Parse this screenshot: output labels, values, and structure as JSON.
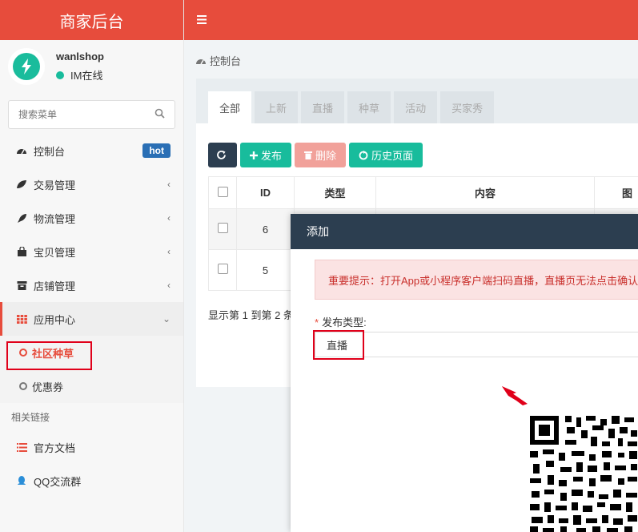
{
  "app": {
    "title": "商家后台"
  },
  "user": {
    "name": "wanlshop",
    "status": "IM在线"
  },
  "search": {
    "placeholder": "搜索菜单"
  },
  "menu": {
    "items": [
      {
        "label": "控制台",
        "badge": "hot"
      },
      {
        "label": "交易管理"
      },
      {
        "label": "物流管理"
      },
      {
        "label": "宝贝管理"
      },
      {
        "label": "店铺管理"
      },
      {
        "label": "应用中心"
      }
    ],
    "sub_items": [
      {
        "label": "社区种草"
      },
      {
        "label": "优惠券"
      }
    ],
    "section_title": "相关链接",
    "links": [
      {
        "label": "官方文档"
      },
      {
        "label": "QQ交流群"
      }
    ]
  },
  "breadcrumb": "控制台",
  "tabs": [
    "全部",
    "上新",
    "直播",
    "种草",
    "活动",
    "买家秀"
  ],
  "toolbar": {
    "publish": "发布",
    "delete": "删除",
    "history": "历史页面"
  },
  "table": {
    "headers": [
      "ID",
      "类型",
      "内容",
      "图"
    ],
    "rows": [
      {
        "id": "6"
      },
      {
        "id": "5"
      }
    ],
    "footer": "显示第 1 到第 2 条"
  },
  "modal": {
    "title": "添加",
    "alert": "重要提示：打开App或小程序客户端扫码直播，直播页无法点击确认",
    "field_label": "发布类型:",
    "field_value": "直播"
  },
  "colors": {
    "brand": "#e74c3c",
    "accent_green": "#18bc9c",
    "dark": "#2c3e50",
    "badge": "#2a6fb5"
  }
}
